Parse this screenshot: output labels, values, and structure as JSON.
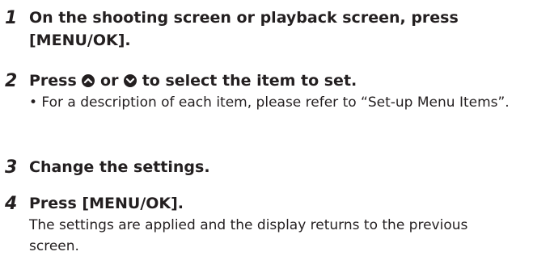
{
  "steps": [
    {
      "number": "1",
      "title": "On the shooting screen or playback screen, press [MENU/OK]."
    },
    {
      "number": "2",
      "title_parts": [
        "Press ",
        " or ",
        " to select the item to set."
      ],
      "icons": [
        "up-arrow-button-icon",
        "down-arrow-button-icon"
      ],
      "bullet": "• For a description of each item, please refer to “Set-up Menu Items”."
    },
    {
      "number": "3",
      "title": "Change the settings."
    },
    {
      "number": "4",
      "title": "Press [MENU/OK].",
      "body": "The settings are applied and the display returns to the previous screen."
    }
  ]
}
